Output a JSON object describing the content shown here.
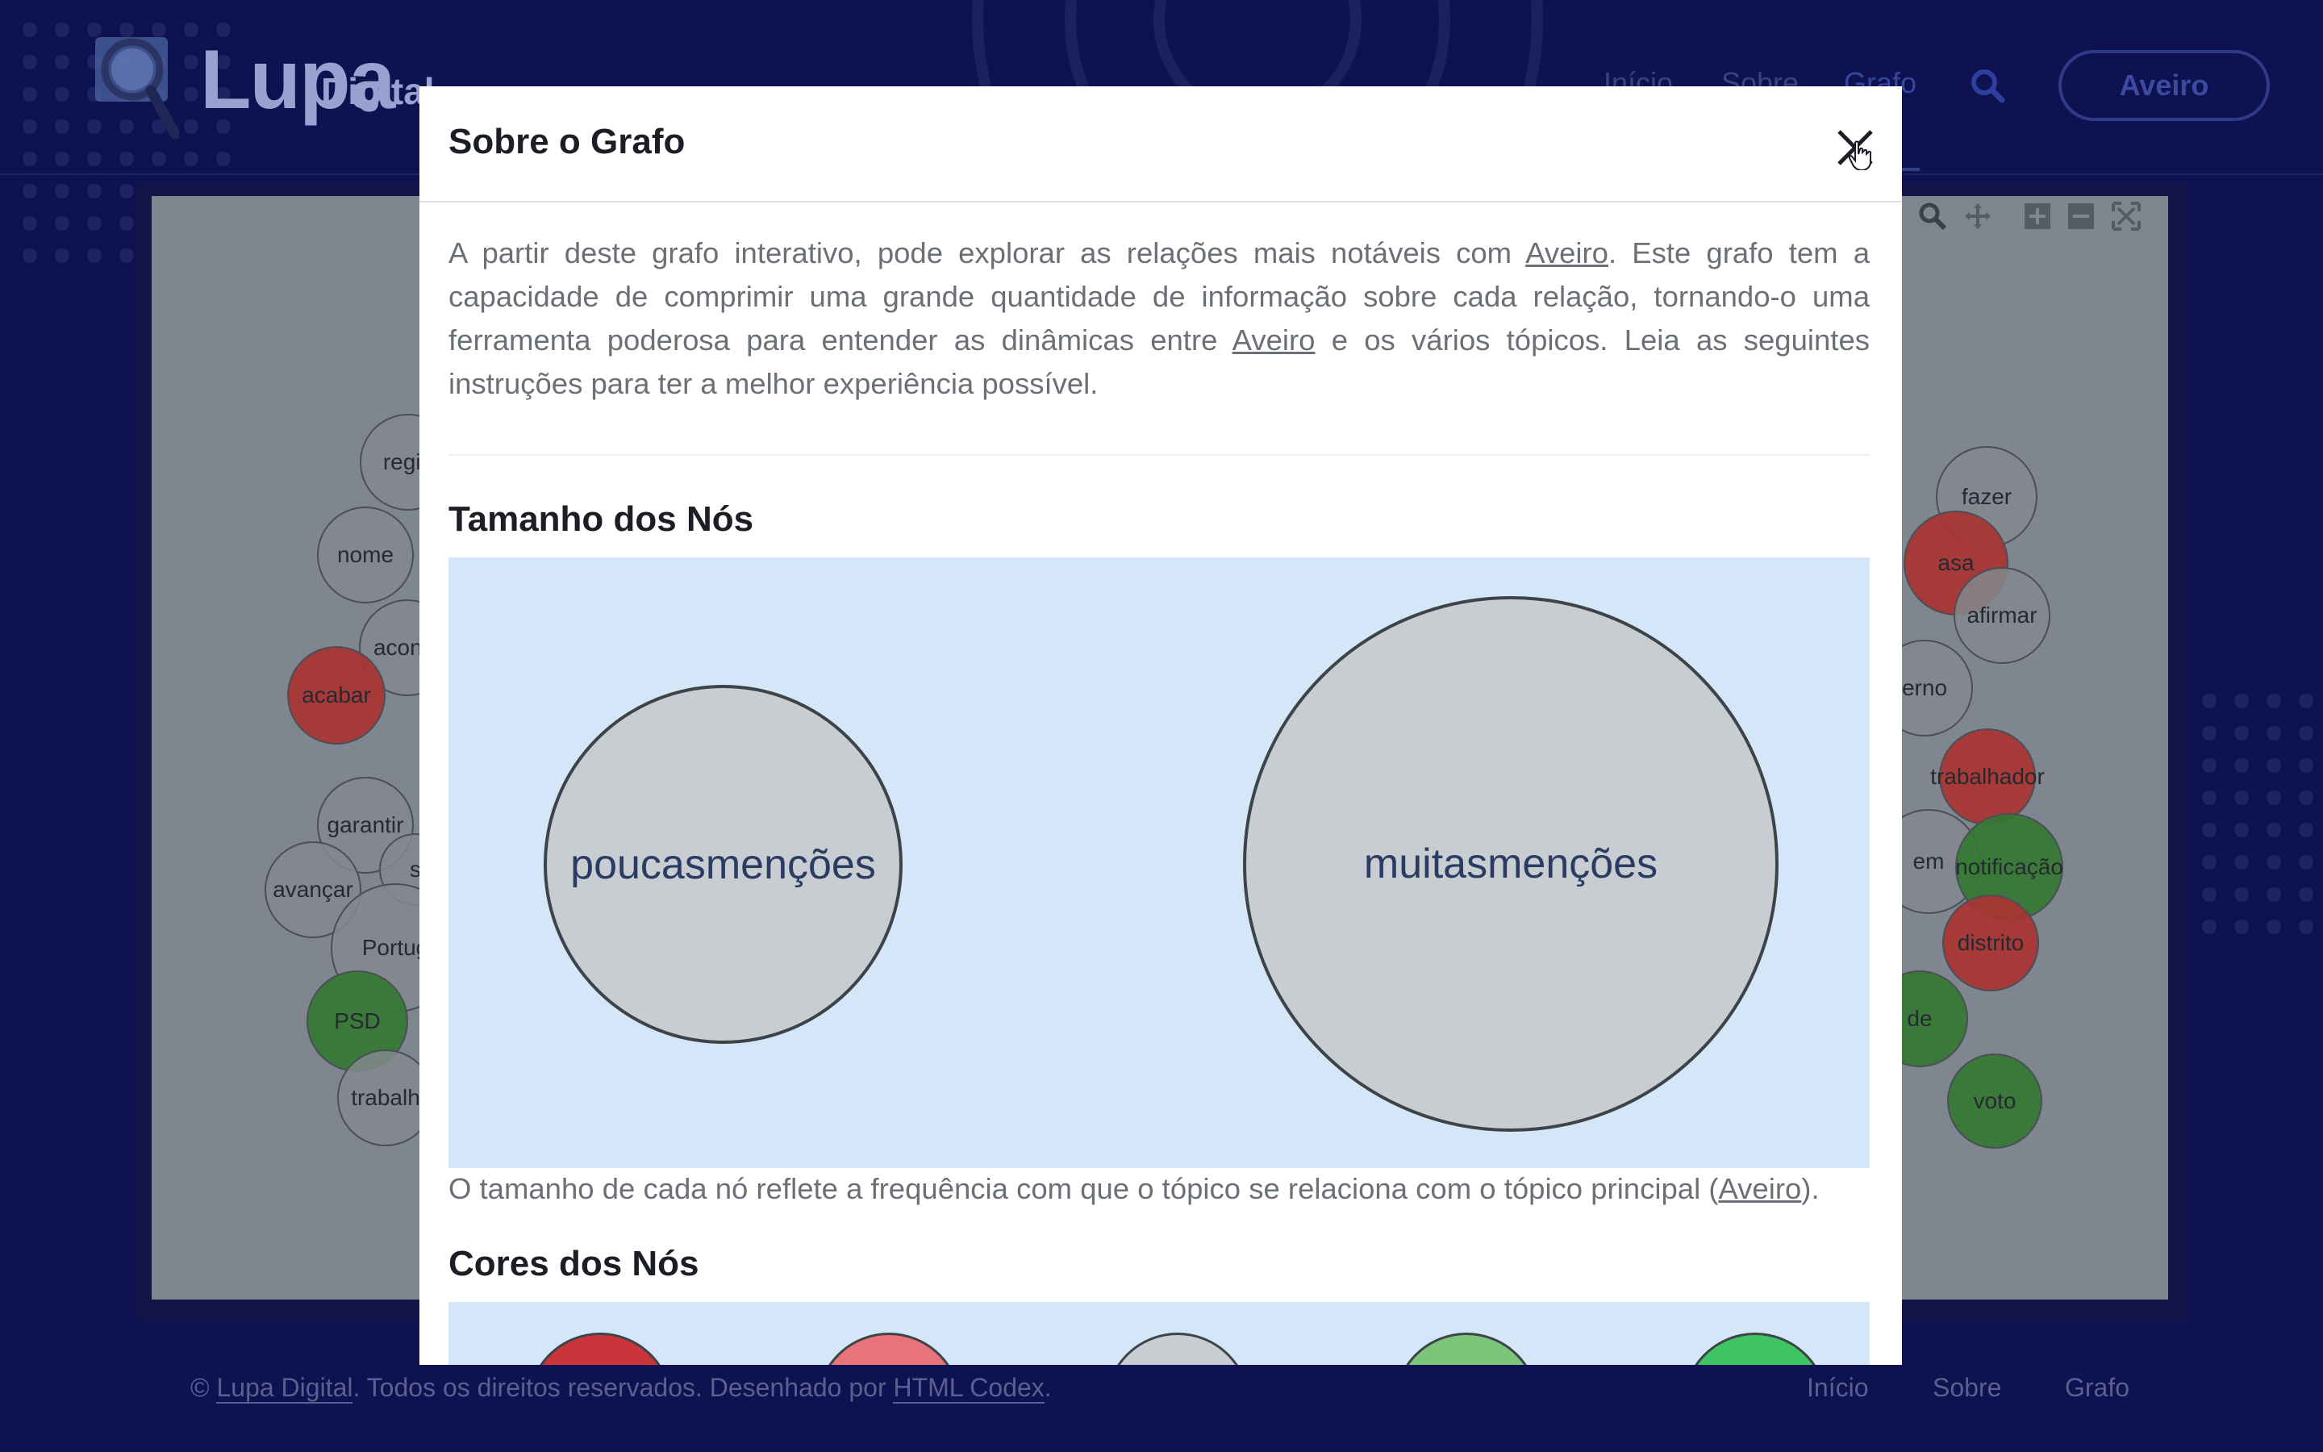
{
  "header": {
    "logo_main": "Lupa",
    "logo_sub": "Digital",
    "nav": [
      {
        "label": "Início"
      },
      {
        "label": "Sobre"
      },
      {
        "label": "Grafo"
      }
    ],
    "topic_button": "Aveiro"
  },
  "graph": {
    "nodes": [
      {
        "label": "regiã",
        "color": "gray"
      },
      {
        "label": "nome",
        "color": "gray"
      },
      {
        "label": "aconte",
        "color": "gray"
      },
      {
        "label": "acabar",
        "color": "red"
      },
      {
        "label": "garantir",
        "color": "gray"
      },
      {
        "label": "s",
        "color": "gray"
      },
      {
        "label": "avançar",
        "color": "gray"
      },
      {
        "label": "Portug",
        "color": "gray"
      },
      {
        "label": "PSD",
        "color": "green"
      },
      {
        "label": "trabalh",
        "color": "gray"
      },
      {
        "label": "fazer",
        "color": "gray"
      },
      {
        "label": "asa",
        "color": "red"
      },
      {
        "label": "afirmar",
        "color": "gray"
      },
      {
        "label": "erno",
        "color": "gray"
      },
      {
        "label": "trabalhador",
        "color": "red"
      },
      {
        "label": "em\ntuga",
        "color": "gray"
      },
      {
        "label": "notificação",
        "color": "green"
      },
      {
        "label": "distrito",
        "color": "red"
      },
      {
        "label": "de",
        "color": "green"
      },
      {
        "label": "voto",
        "color": "green"
      }
    ]
  },
  "modal": {
    "title": "Sobre o Grafo",
    "intro_1": "A partir deste grafo interativo, pode explorar as relações mais notáveis com ",
    "intro_link_1": "Aveiro",
    "intro_2": ". Este grafo tem a capacidade de comprimir uma grande quantidade de informação sobre cada relação, tornando-o uma ferramenta poderosa para entender as dinâmicas entre ",
    "intro_link_2": "Aveiro",
    "intro_3": " e os vários tópicos. Leia as seguintes instruções para ter a melhor experiência possível.",
    "size_section": {
      "title": "Tamanho dos Nós",
      "small_label": "poucas menções",
      "large_label": "muitas menções",
      "caption_1": "O tamanho de cada nó reflete a frequência com que o tópico se relaciona com o tópico principal (",
      "caption_link": "Aveiro",
      "caption_2": ")."
    },
    "color_section": {
      "title": "Cores dos Nós",
      "swatches": [
        "#c9353a",
        "#e8737a",
        "#c8cdd1",
        "#7cc67c",
        "#3fc463"
      ]
    }
  },
  "footer": {
    "copyright_prefix": "© ",
    "brand": "Lupa Digital",
    "middle": ". Todos os direitos reservados. Desenhado por ",
    "designer": "HTML Codex",
    "end": ".",
    "links": [
      {
        "label": "Início"
      },
      {
        "label": "Sobre"
      },
      {
        "label": "Grafo"
      }
    ]
  }
}
